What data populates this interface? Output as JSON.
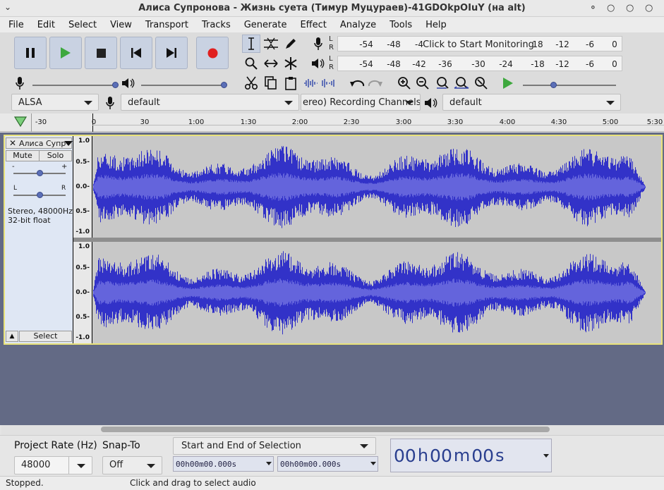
{
  "window": {
    "title": "Алиса Супронова - Жизнь суета (Тимур Муцураев)-41GDOkpOIuY (на alt)"
  },
  "menu": [
    "File",
    "Edit",
    "Select",
    "View",
    "Transport",
    "Tracks",
    "Generate",
    "Effect",
    "Analyze",
    "Tools",
    "Help"
  ],
  "meters": {
    "record_scale": [
      "-54",
      "-48",
      "-4"
    ],
    "record_prompt": "Click to Start Monitoring",
    "record_scale_right": [
      "18",
      "-12",
      "-6",
      "0"
    ],
    "play_scale": [
      "-54",
      "-48",
      "-42",
      "-36",
      "-30",
      "-24",
      "-18",
      "-12",
      "-6",
      "0"
    ],
    "left": "L",
    "right": "R"
  },
  "devices": {
    "host": "ALSA",
    "recording_device": "default",
    "channels": "ereo) Recording Channels",
    "playback_device": "default"
  },
  "ruler": [
    "-30",
    "0",
    "30",
    "1:00",
    "1:30",
    "2:00",
    "2:30",
    "3:00",
    "3:30",
    "4:00",
    "4:30",
    "5:00",
    "5:30"
  ],
  "track": {
    "name": "Алиса Супр",
    "mute": "Mute",
    "solo": "Solo",
    "gain_minus": "-",
    "gain_plus": "+",
    "pan_left": "L",
    "pan_right": "R",
    "info_rate": "Stereo, 48000Hz",
    "info_format": "32-bit float",
    "select": "Select",
    "vscale": [
      "1.0",
      "0.5-",
      "0.0-",
      "0.5-",
      "-1.0"
    ]
  },
  "bottom": {
    "project_rate_label": "Project Rate (Hz)",
    "project_rate": "48000",
    "snap_label": "Snap-To",
    "snap_value": "Off",
    "selection_mode": "Start and End of Selection",
    "sel_start": "00h00m00.000s",
    "sel_end": "00h00m00.000s",
    "big_time": {
      "h1": "0",
      "h2": "0",
      "hu": "h",
      "m1": "0",
      "m2": "0",
      "mu": "m",
      "s1": "0",
      "s2": "0",
      "su": "s"
    }
  },
  "status": {
    "left": "Stopped.",
    "center": "Click and drag to select audio"
  },
  "colors": {
    "waveform": "#3232c8",
    "waveform_rms": "#6464dc",
    "track_bg": "#c8c8c8",
    "highlight": "#e9e27a"
  }
}
